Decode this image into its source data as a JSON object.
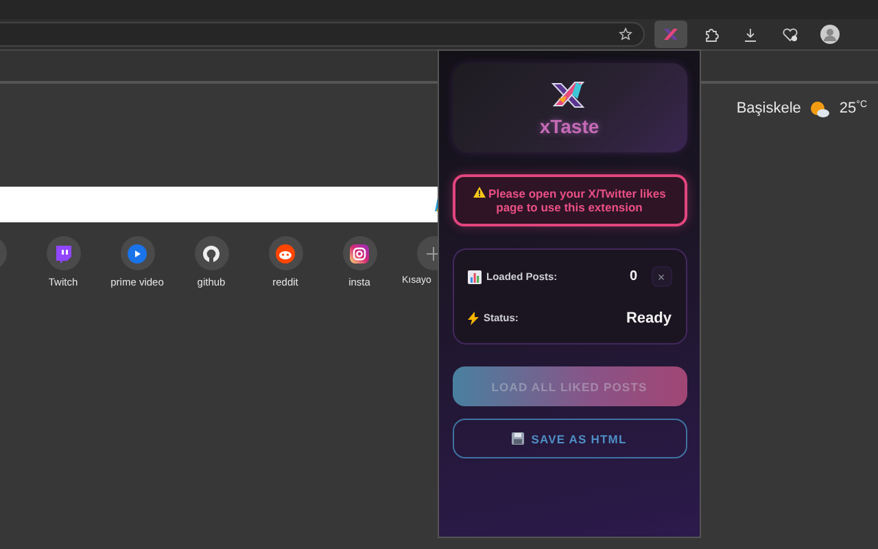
{
  "toolbar": {
    "extension_active": true
  },
  "weather": {
    "location": "Başiskele",
    "temperature": "25",
    "unit": "°C"
  },
  "shortcuts": [
    {
      "kind": "blank"
    },
    {
      "label": "Twitch",
      "kind": "twitch"
    },
    {
      "label": "prime video",
      "kind": "play"
    },
    {
      "label": "github",
      "kind": "github"
    },
    {
      "label": "reddit",
      "kind": "reddit"
    },
    {
      "label": "insta",
      "kind": "camera"
    },
    {
      "label": "Kısayo",
      "kind": "add"
    }
  ],
  "popup": {
    "title": "xTaste",
    "warning": "Please open your X/Twitter likes page to use this extension",
    "stats": [
      {
        "kind": "chart",
        "label": "Loaded Posts:",
        "value": "0",
        "clear_button": "×"
      },
      {
        "kind": "bolt",
        "label": "Status:",
        "value": "Ready"
      }
    ],
    "buttons": [
      {
        "kind": "primary",
        "label": "LOAD ALL LIKED POSTS",
        "disabled": true
      },
      {
        "kind": "outline",
        "label": "SAVE AS HTML",
        "disabled": false
      }
    ]
  }
}
